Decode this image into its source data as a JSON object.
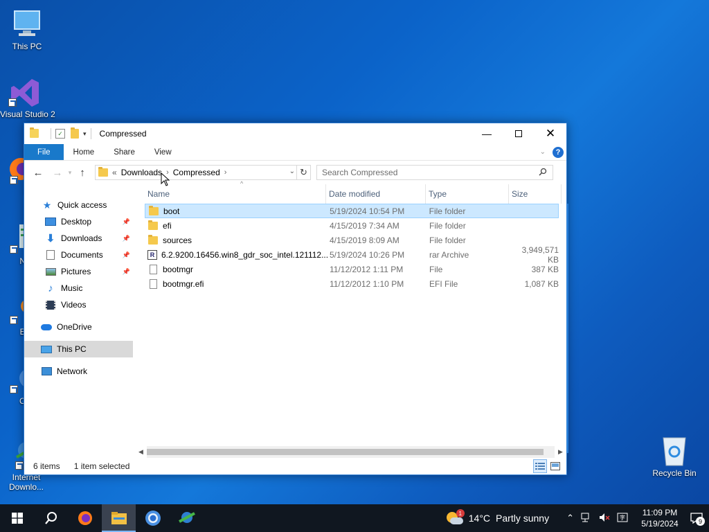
{
  "desktop": {
    "icons": [
      {
        "label": "This PC"
      },
      {
        "label": "Visual Studio 2"
      },
      {
        "label": "Fir"
      },
      {
        "label": "Note"
      },
      {
        "label": "Ever"
      },
      {
        "label": "Chro"
      },
      {
        "label": "Internet Downlo..."
      },
      {
        "label": "Recycle Bin"
      }
    ]
  },
  "window": {
    "title": "Compressed",
    "ribbon_tabs": [
      "File",
      "Home",
      "Share",
      "View"
    ],
    "address": {
      "overflow": "«",
      "crumbs": [
        "Downloads",
        "Compressed"
      ]
    },
    "search_placeholder": "Search Compressed",
    "nav": {
      "quick_access": "Quick access",
      "items": [
        "Desktop",
        "Downloads",
        "Documents",
        "Pictures",
        "Music",
        "Videos"
      ],
      "onedrive": "OneDrive",
      "this_pc": "This PC",
      "network": "Network"
    },
    "columns": {
      "name": "Name",
      "date": "Date modified",
      "type": "Type",
      "size": "Size"
    },
    "files": [
      {
        "name": "boot",
        "date": "5/19/2024 10:54 PM",
        "type": "File folder",
        "size": "",
        "icon": "folder-icon"
      },
      {
        "name": "efi",
        "date": "4/15/2019 7:34 AM",
        "type": "File folder",
        "size": "",
        "icon": "folder-icon"
      },
      {
        "name": "sources",
        "date": "4/15/2019 8:09 AM",
        "type": "File folder",
        "size": "",
        "icon": "folder-icon"
      },
      {
        "name": "6.2.9200.16456.win8_gdr_soc_intel.121112...",
        "date": "5/19/2024 10:26 PM",
        "type": "rar Archive",
        "size": "3,949,571 KB",
        "icon": "rar-icon"
      },
      {
        "name": "bootmgr",
        "date": "11/12/2012 1:11 PM",
        "type": "File",
        "size": "387 KB",
        "icon": "file-icon"
      },
      {
        "name": "bootmgr.efi",
        "date": "11/12/2012 1:10 PM",
        "type": "EFI File",
        "size": "1,087 KB",
        "icon": "file-icon"
      }
    ],
    "status": {
      "count": "6 items",
      "selected": "1 item selected"
    }
  },
  "taskbar": {
    "weather_temp": "14°C",
    "weather_text": "Partly sunny",
    "weather_badge": "1",
    "time": "11:09 PM",
    "date": "5/19/2024",
    "notifications": "9"
  },
  "colors": {
    "accent": "#1979ca",
    "selection": "#cce8ff",
    "folder": "#f5c94d"
  }
}
